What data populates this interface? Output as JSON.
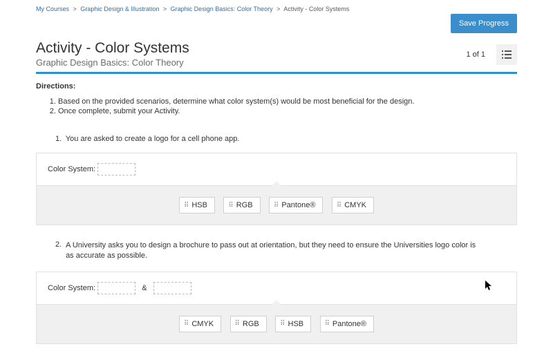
{
  "breadcrumb": {
    "items": [
      "My Courses",
      "Graphic Design & Illustration",
      "Graphic Design Basics: Color Theory"
    ],
    "current": "Activity - Color Systems"
  },
  "save_btn": "Save Progress",
  "header": {
    "title": "Activity - Color Systems",
    "subtitle": "Graphic Design Basics: Color Theory",
    "counter": "1 of 1"
  },
  "directions": {
    "label": "Directions:",
    "items": [
      "Based on the provided scenarios, determine what color system(s) would be most beneficial for the design.",
      "Once complete, submit your Activity."
    ]
  },
  "q1": {
    "num": "1.",
    "text": "You are asked to create a logo for a cell phone app.",
    "label": "Color System:",
    "chips": [
      "HSB",
      "RGB",
      "Pantone®",
      "CMYK"
    ]
  },
  "q2": {
    "num": "2.",
    "text": "A University asks you to design a brochure to pass out at orientation, but they need to ensure the Universities logo color is as accurate as possible.",
    "label": "Color System:",
    "amp": "&",
    "chips": [
      "CMYK",
      "RGB",
      "HSB",
      "Pantone®"
    ]
  }
}
